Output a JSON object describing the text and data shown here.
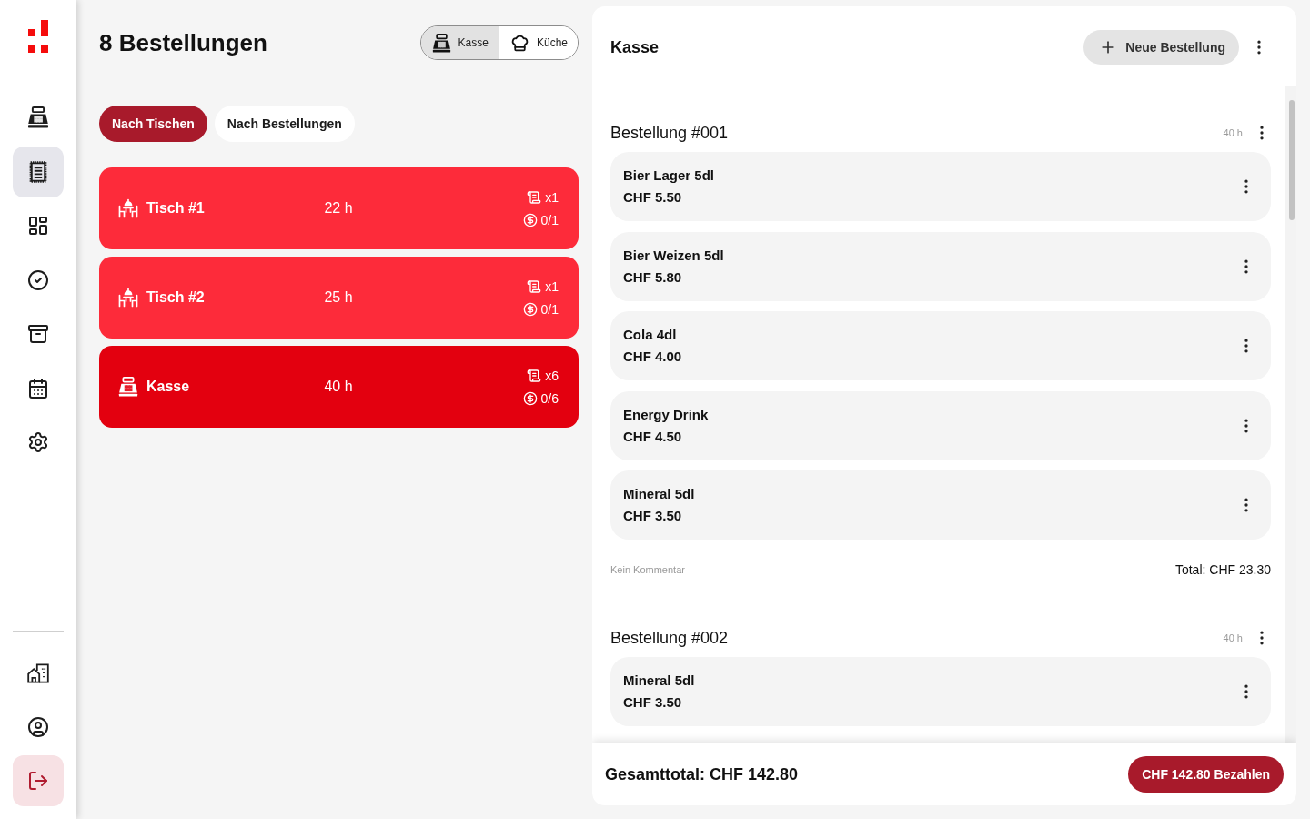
{
  "sidebar": {
    "top_items": [
      {
        "kind": "register",
        "selected": false
      },
      {
        "kind": "orders",
        "selected": true
      },
      {
        "kind": "dashboard",
        "selected": false
      },
      {
        "kind": "check",
        "selected": false
      },
      {
        "kind": "archive",
        "selected": false
      },
      {
        "kind": "calendar",
        "selected": false
      },
      {
        "kind": "settings",
        "selected": false
      }
    ],
    "bottom_items": [
      {
        "kind": "locations",
        "selected": false
      },
      {
        "kind": "profile",
        "selected": false
      },
      {
        "kind": "logout",
        "selected": false
      }
    ]
  },
  "orders_panel": {
    "title": "8 Bestellungen",
    "view_switch": [
      {
        "kind": "register",
        "label": "Kasse",
        "selected": true
      },
      {
        "kind": "kitchen",
        "label": "Küche",
        "selected": false
      }
    ],
    "filters": [
      {
        "label": "Nach Tischen",
        "selected": true
      },
      {
        "label": "Nach Bestellungen",
        "selected": false
      }
    ],
    "tables": [
      {
        "kind": "table",
        "name": "Tisch #1",
        "time": "22 h",
        "orders": "x1",
        "paid": "0/1",
        "selected": false
      },
      {
        "kind": "table",
        "name": "Tisch #2",
        "time": "25 h",
        "orders": "x1",
        "paid": "0/1",
        "selected": false
      },
      {
        "kind": "register",
        "name": "Kasse",
        "time": "40 h",
        "orders": "x6",
        "paid": "0/6",
        "selected": true
      }
    ]
  },
  "detail_panel": {
    "title": "Kasse",
    "new_order_button": "Neue Bestellung",
    "orders": [
      {
        "title": "Bestellung #001",
        "age": "40 h",
        "items": [
          {
            "name": "Bier Lager 5dl",
            "price": "CHF 5.50"
          },
          {
            "name": "Bier Weizen 5dl",
            "price": "CHF 5.80"
          },
          {
            "name": "Cola 4dl",
            "price": "CHF 4.00"
          },
          {
            "name": "Energy Drink",
            "price": "CHF 4.50"
          },
          {
            "name": "Mineral 5dl",
            "price": "CHF 3.50"
          }
        ],
        "comment": "Kein Kommentar",
        "total": "Total: CHF 23.30"
      },
      {
        "title": "Bestellung #002",
        "age": "40 h",
        "items": [
          {
            "name": "Mineral 5dl",
            "price": "CHF 3.50"
          }
        ]
      }
    ],
    "footer": {
      "grand_total": "Gesamttotal: CHF 142.80",
      "pay_button": "CHF 142.80 Bezahlen"
    }
  }
}
